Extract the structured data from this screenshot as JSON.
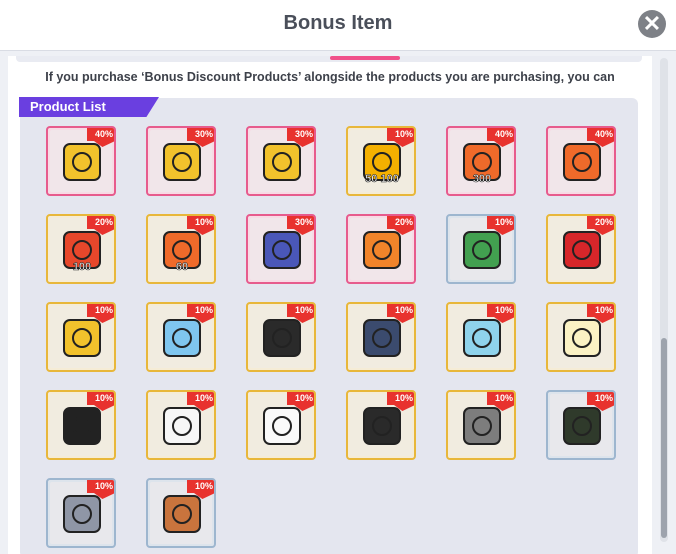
{
  "dialog": {
    "title": "Bonus Item",
    "close_label": "✕"
  },
  "notice": "If you purchase ‘Bonus Discount Products’ alongside the products you are purchasing, you can",
  "product_list_label": "Product List",
  "items": [
    {
      "discount": "40%",
      "frame": "pink",
      "icon": "gift-box-v-icon",
      "iconColor": "#f2c22c",
      "numbers": ""
    },
    {
      "discount": "30%",
      "frame": "pink",
      "icon": "gift-box-z-icon",
      "iconColor": "#f2c22c",
      "numbers": ""
    },
    {
      "discount": "30%",
      "frame": "pink",
      "icon": "gift-box-n-icon",
      "iconColor": "#f2c22c",
      "numbers": ""
    },
    {
      "discount": "10%",
      "frame": "yellow",
      "icon": "winged-cards-icon",
      "iconColor": "#f4b000",
      "numbers": "50 100"
    },
    {
      "discount": "40%",
      "frame": "pink",
      "icon": "card-300-icon",
      "iconColor": "#ef6a2a",
      "numbers": "300"
    },
    {
      "discount": "40%",
      "frame": "pink",
      "icon": "card-icon",
      "iconColor": "#ef6a2a",
      "numbers": ""
    },
    {
      "discount": "20%",
      "frame": "yellow",
      "icon": "gift-100-icon",
      "iconColor": "#e7472b",
      "numbers": "100"
    },
    {
      "discount": "10%",
      "frame": "yellow",
      "icon": "card-60-icon",
      "iconColor": "#ef6a2a",
      "numbers": "60"
    },
    {
      "discount": "30%",
      "frame": "pink",
      "icon": "bag-blue-icon",
      "iconColor": "#4a57b8",
      "numbers": ""
    },
    {
      "discount": "20%",
      "frame": "pink",
      "icon": "bag-orange-icon",
      "iconColor": "#f1842a",
      "numbers": ""
    },
    {
      "discount": "10%",
      "frame": "blue",
      "icon": "cash-box-icon",
      "iconColor": "#42a050",
      "numbers": ""
    },
    {
      "discount": "20%",
      "frame": "yellow",
      "icon": "red-box-icon",
      "iconColor": "#d7262a",
      "numbers": ""
    },
    {
      "discount": "10%",
      "frame": "yellow",
      "icon": "yellow-box-icon",
      "iconColor": "#f2c22c",
      "numbers": ""
    },
    {
      "discount": "10%",
      "frame": "yellow",
      "icon": "blue-jacket-icon",
      "iconColor": "#7fc6ef",
      "numbers": ""
    },
    {
      "discount": "10%",
      "frame": "yellow",
      "icon": "black-swimsuit-icon",
      "iconColor": "#2a2a2a",
      "numbers": ""
    },
    {
      "discount": "10%",
      "frame": "yellow",
      "icon": "overalls-icon",
      "iconColor": "#3b4b6e",
      "numbers": ""
    },
    {
      "discount": "10%",
      "frame": "yellow",
      "icon": "blue-tee-icon",
      "iconColor": "#8fd3ec",
      "numbers": ""
    },
    {
      "discount": "10%",
      "frame": "yellow",
      "icon": "cream-dress-icon",
      "iconColor": "#fbf2c4",
      "numbers": ""
    },
    {
      "discount": "10%",
      "frame": "yellow",
      "icon": "black-outfit-icon",
      "iconColor": "#222222",
      "numbers": ""
    },
    {
      "discount": "10%",
      "frame": "yellow",
      "icon": "white-hoodie-icon",
      "iconColor": "#f7f7f7",
      "numbers": ""
    },
    {
      "discount": "10%",
      "frame": "yellow",
      "icon": "white-swimsuit-icon",
      "iconColor": "#fafafa",
      "numbers": ""
    },
    {
      "discount": "10%",
      "frame": "yellow",
      "icon": "black-swimsuit2-icon",
      "iconColor": "#2a2a2a",
      "numbers": ""
    },
    {
      "discount": "10%",
      "frame": "yellow",
      "icon": "gray-swimsuit-icon",
      "iconColor": "#7d7d7d",
      "numbers": ""
    },
    {
      "discount": "10%",
      "frame": "blue",
      "icon": "character-cap-icon",
      "iconColor": "#2f3a2b",
      "numbers": ""
    },
    {
      "discount": "10%",
      "frame": "blue",
      "icon": "character-elephant-icon",
      "iconColor": "#8f96a6",
      "numbers": ""
    },
    {
      "discount": "10%",
      "frame": "blue",
      "icon": "character-cat-icon",
      "iconColor": "#c9743d",
      "numbers": ""
    }
  ]
}
